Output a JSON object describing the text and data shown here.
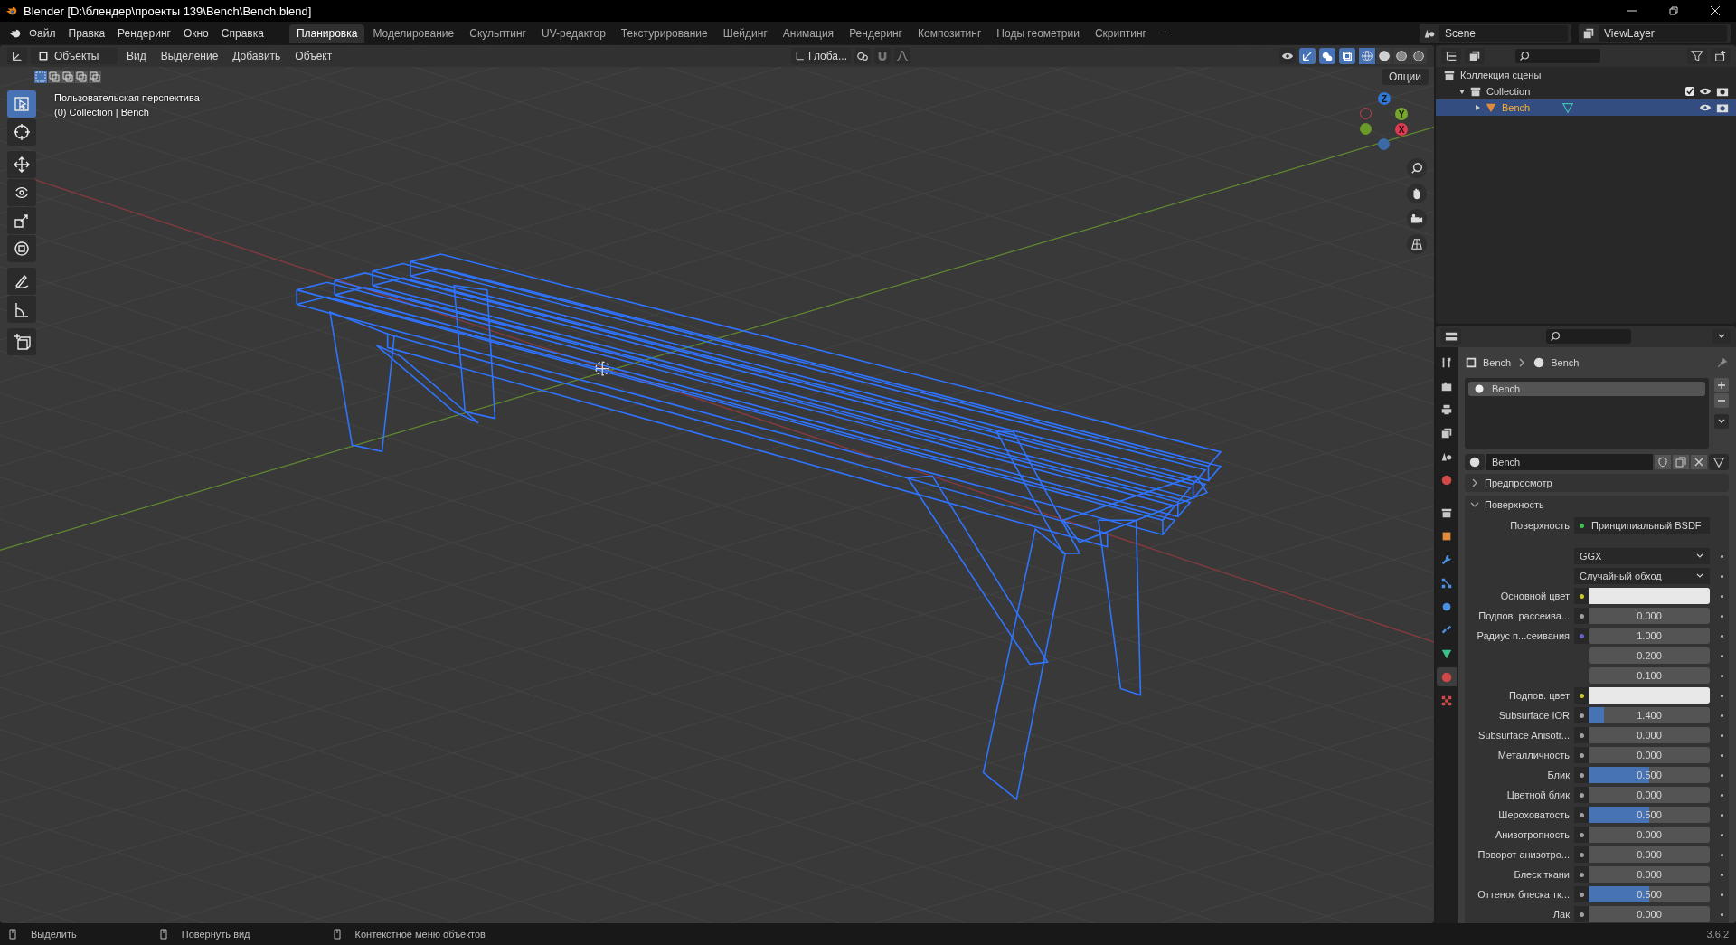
{
  "window": {
    "title": "Blender [D:\\блендер\\проекты 139\\Bench\\Bench.blend]"
  },
  "menu": [
    "Файл",
    "Правка",
    "Рендеринг",
    "Окно",
    "Справка"
  ],
  "workspaces": [
    {
      "label": "Планировка",
      "selected": true
    },
    {
      "label": "Моделирование",
      "selected": false
    },
    {
      "label": "Скульптинг",
      "selected": false
    },
    {
      "label": "UV-редактор",
      "selected": false
    },
    {
      "label": "Текстурирование",
      "selected": false
    },
    {
      "label": "Шейдинг",
      "selected": false
    },
    {
      "label": "Анимация",
      "selected": false
    },
    {
      "label": "Рендеринг",
      "selected": false
    },
    {
      "label": "Композитинг",
      "selected": false
    },
    {
      "label": "Ноды геометрии",
      "selected": false
    },
    {
      "label": "Скриптинг",
      "selected": false
    }
  ],
  "add_workspace": "+",
  "scene": {
    "name": "Scene",
    "view_layer": "ViewLayer"
  },
  "viewport": {
    "mode": "Объекты",
    "menu": [
      "Вид",
      "Выделение",
      "Добавить",
      "Объект"
    ],
    "orientation": "Глоба...",
    "options": "Опции",
    "view_name": "Пользовательская перспектива",
    "context": "(0) Collection | Bench",
    "select_modes": [
      {
        "selected": true
      },
      {
        "selected": false
      },
      {
        "selected": false
      },
      {
        "selected": false
      },
      {
        "selected": false
      }
    ],
    "shading": [
      {
        "kind": "wireframe",
        "selected": true
      },
      {
        "kind": "solid",
        "selected": false
      },
      {
        "kind": "material",
        "selected": false
      },
      {
        "kind": "rendered",
        "selected": false
      }
    ],
    "tools": [
      {
        "kind": "select",
        "selected": true
      },
      {
        "kind": "cursor",
        "selected": false
      },
      {
        "kind": "move",
        "selected": false
      },
      {
        "kind": "rotate",
        "selected": false
      },
      {
        "kind": "scale",
        "selected": false
      },
      {
        "kind": "transform",
        "selected": false
      },
      {
        "kind": "annotate",
        "selected": false
      },
      {
        "kind": "measure",
        "selected": false
      },
      {
        "kind": "add_cube",
        "selected": false
      }
    ],
    "gizmo_axes": [
      "Z",
      "Y",
      "X"
    ]
  },
  "outliner": {
    "items": [
      {
        "label": "Коллекция сцены",
        "kind": "scene_collection",
        "selected": false,
        "children": [
          {
            "label": "Collection",
            "kind": "collection",
            "selected": false,
            "expanded": true,
            "checked": true,
            "children": [
              {
                "label": "Bench",
                "kind": "mesh",
                "selected": true,
                "expanded": false
              }
            ]
          }
        ]
      }
    ]
  },
  "properties": {
    "tabs": [
      {
        "kind": "tool",
        "selected": false
      },
      {
        "kind": "render",
        "selected": false
      },
      {
        "kind": "output",
        "selected": false
      },
      {
        "kind": "view_layer",
        "selected": false
      },
      {
        "kind": "scene",
        "selected": false
      },
      {
        "kind": "world",
        "selected": false
      },
      {
        "kind": "collection",
        "selected": false
      },
      {
        "kind": "object",
        "selected": false
      },
      {
        "kind": "modifier",
        "selected": false
      },
      {
        "kind": "particles",
        "selected": false
      },
      {
        "kind": "physics",
        "selected": false
      },
      {
        "kind": "constraints",
        "selected": false
      },
      {
        "kind": "data",
        "selected": false
      },
      {
        "kind": "material",
        "selected": true
      },
      {
        "kind": "texture",
        "selected": false
      }
    ],
    "breadcrumb": [
      "Bench",
      "Bench"
    ],
    "slots": [
      {
        "label": "Bench",
        "selected": true
      }
    ],
    "material": "Bench",
    "panels": [
      {
        "label": "Предпросмотр",
        "expanded": false
      },
      {
        "label": "Поверхность",
        "expanded": true
      }
    ],
    "rows": [
      {
        "kind": "shader",
        "label": "Поверхность",
        "value": "Принципиальный BSDF",
        "color": "#3fbf4f"
      },
      {
        "kind": "dropdown",
        "value": "GGX"
      },
      {
        "kind": "dropdown",
        "value": "Случайный обход"
      },
      {
        "kind": "color",
        "label": "Основной цвет",
        "color": "#c7c729"
      },
      {
        "kind": "value",
        "label": "Подпов. рассеива...",
        "value": "0.000",
        "level": 0,
        "color": "#a1a1a1"
      },
      {
        "kind": "vector",
        "label": "Радиус п...сеивания",
        "values": [
          "1.000",
          "0.200",
          "0.100"
        ],
        "color": "#6363c7"
      },
      {
        "kind": "color",
        "label": "Подпов. цвет",
        "color": "#c7c729"
      },
      {
        "kind": "value",
        "label": "Subsurface IOR",
        "value": "1.400",
        "level": 0.13,
        "color": "#a1a1a1"
      },
      {
        "kind": "value",
        "label": "Subsurface Anisotr...",
        "value": "0.000",
        "level": 0,
        "color": "#a1a1a1"
      },
      {
        "kind": "value",
        "label": "Металличность",
        "value": "0.000",
        "level": 0,
        "color": "#a1a1a1"
      },
      {
        "kind": "value",
        "label": "Блик",
        "value": "0.500",
        "level": 0.5,
        "color": "#a1a1a1"
      },
      {
        "kind": "value",
        "label": "Цветной блик",
        "value": "0.000",
        "level": 0,
        "color": "#a1a1a1"
      },
      {
        "kind": "value",
        "label": "Шероховатость",
        "value": "0.500",
        "level": 0.5,
        "color": "#a1a1a1"
      },
      {
        "kind": "value",
        "label": "Анизотропность",
        "value": "0.000",
        "level": 0,
        "color": "#a1a1a1"
      },
      {
        "kind": "value",
        "label": "Поворот анизотро...",
        "value": "0.000",
        "level": 0,
        "color": "#a1a1a1"
      },
      {
        "kind": "value",
        "label": "Блеск ткани",
        "value": "0.000",
        "level": 0,
        "color": "#a1a1a1"
      },
      {
        "kind": "value",
        "label": "Оттенок блеска тк...",
        "value": "0.500",
        "level": 0.5,
        "color": "#a1a1a1"
      },
      {
        "kind": "value",
        "label": "Лак",
        "value": "0.000",
        "level": 0,
        "color": "#a1a1a1"
      }
    ]
  },
  "status_bar": {
    "hints": [
      "Выделить",
      "Повернуть вид",
      "Контекстное меню объектов"
    ],
    "version": "3.6.2"
  }
}
